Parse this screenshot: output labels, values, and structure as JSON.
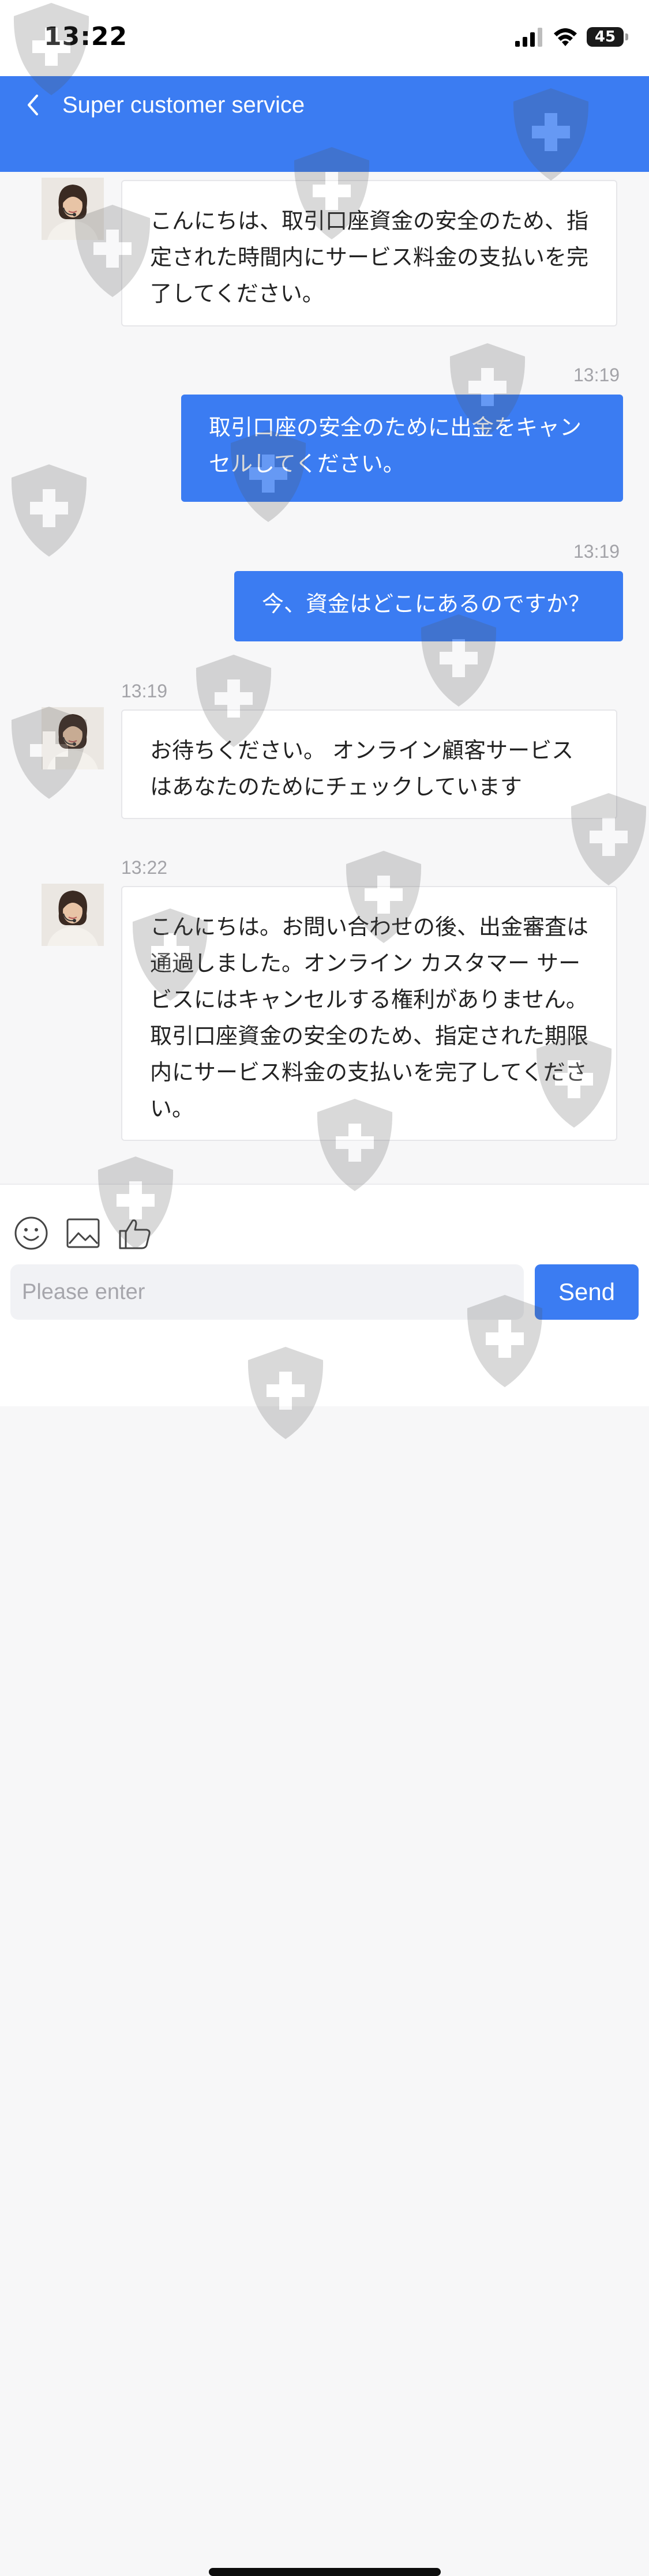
{
  "status_bar": {
    "time": "13:22",
    "battery": "45"
  },
  "header": {
    "title": "Super customer service"
  },
  "messages": [
    {
      "side": "in",
      "timestamp": "",
      "text": "こんにちは、取引口座資金の安全のため、指定された時間内にサービス料金の支払いを完了してください。"
    },
    {
      "side": "out",
      "timestamp": "13:19",
      "text": "取引口座の安全のために出金をキャンセルしてください。"
    },
    {
      "side": "out",
      "timestamp": "13:19",
      "text": "今、資金はどこにあるのですか？"
    },
    {
      "side": "in",
      "timestamp": "13:19",
      "text": "お待ちください。 オンライン顧客サービスはあなたのためにチェックしています"
    },
    {
      "side": "in",
      "timestamp": "13:22",
      "text": "こんにちは。お問い合わせの後、出金審査は通過しました。オンライン カスタマー サービスにはキャンセルする権利がありません。取引口座資金の安全のため、指定された期限内にサービス料金の支払いを完了してください。"
    }
  ],
  "composer": {
    "placeholder": "Please enter",
    "send_label": "Send",
    "tools": [
      "emoji-icon",
      "image-icon",
      "thumbs-up-icon"
    ]
  },
  "colors": {
    "accent": "#3b7cf2",
    "background": "#f7f7f8"
  }
}
